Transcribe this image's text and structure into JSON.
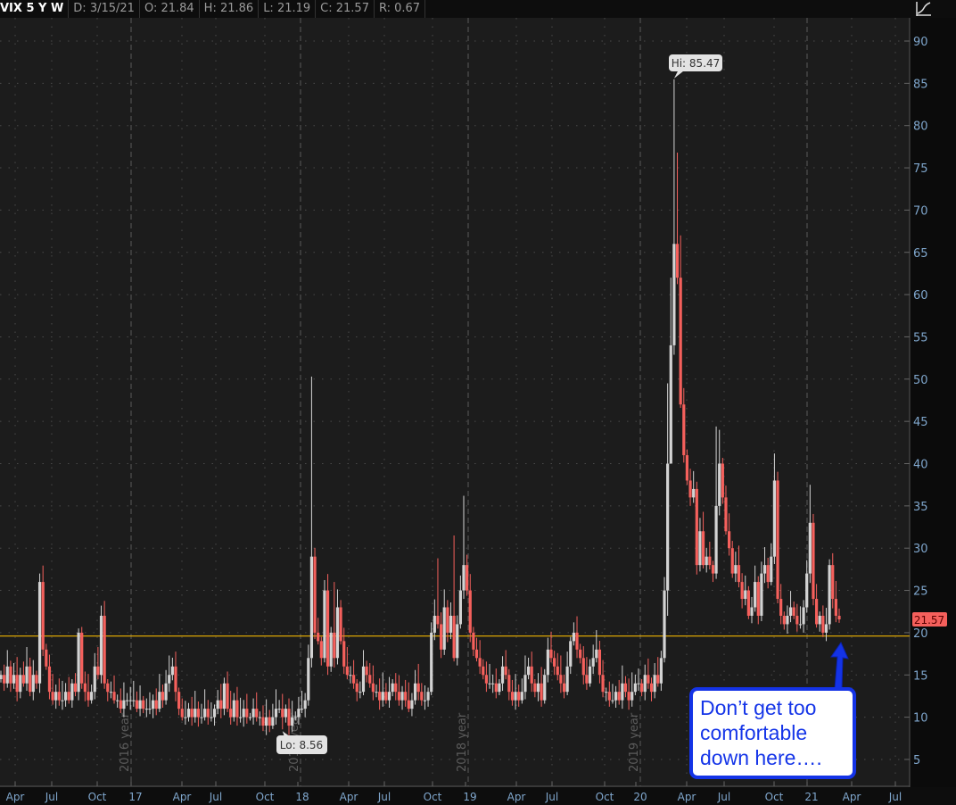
{
  "header": {
    "symbol": "VIX 5 Y W",
    "date": "D: 3/15/21",
    "open": "O: 21.84",
    "high": "H: 21.86",
    "low": "L: 21.19",
    "close": "C: 21.57",
    "range": "R: 0.67"
  },
  "icons": {
    "top_right": "study-icon"
  },
  "annotation": {
    "text_lines": [
      "Don’t get too",
      "comfortable",
      "down here…."
    ],
    "color": "#1433e6"
  },
  "colors": {
    "up": "#d3d3d3",
    "down": "#f5605c",
    "level_line": "#f0b400",
    "axis_text": "#7fa6cc",
    "background": "#1c1c1c"
  },
  "chart_data": {
    "type": "candlestick",
    "title": "VIX 5 Y W",
    "interval": "weekly",
    "ylim": [
      1,
      93
    ],
    "y_ticks": [
      5,
      10,
      15,
      20,
      25,
      30,
      35,
      40,
      45,
      50,
      55,
      60,
      65,
      70,
      75,
      80,
      85,
      90
    ],
    "x_tick_labels": [
      "Apr",
      "Jul",
      "Oct",
      "17",
      "Apr",
      "Jul",
      "Oct",
      "18",
      "Apr",
      "Jul",
      "Oct",
      "19",
      "Apr",
      "Jul",
      "Oct",
      "20",
      "Apr",
      "Jul",
      "Oct",
      "21",
      "Apr",
      "Jul"
    ],
    "year_separators": [
      "2016 year",
      "2017 year",
      "2018 year",
      "2019 year",
      ""
    ],
    "closes": [
      15,
      14,
      16,
      14,
      15,
      13,
      15,
      14,
      16,
      13,
      15,
      14,
      26,
      18,
      16,
      13,
      12,
      13,
      12,
      12,
      13,
      12,
      14,
      13,
      20,
      14,
      13,
      12,
      13,
      16,
      15,
      22,
      14,
      13,
      13,
      12,
      12,
      11,
      12,
      12,
      12,
      12,
      11,
      12,
      11,
      11,
      11,
      12,
      11,
      13,
      12,
      14,
      15,
      16,
      13,
      11,
      10,
      10,
      11,
      10,
      11,
      10,
      10,
      11,
      10,
      10,
      11,
      12,
      11,
      14,
      11,
      10,
      12,
      10,
      10,
      11,
      10,
      10,
      11,
      10,
      10,
      9,
      10,
      9,
      10,
      11,
      11,
      10,
      11,
      9,
      10,
      10,
      11,
      11,
      12,
      17,
      29,
      20,
      19,
      17,
      25,
      16,
      20,
      17,
      23,
      19,
      16,
      15,
      15,
      14,
      13,
      13,
      16,
      15,
      14,
      13,
      13,
      12,
      13,
      12,
      13,
      14,
      13,
      12,
      13,
      12,
      11,
      12,
      14,
      13,
      12,
      12,
      13,
      20,
      22,
      21,
      18,
      23,
      20,
      22,
      17,
      21,
      25,
      28,
      25,
      20,
      18,
      17,
      16,
      15,
      14,
      14,
      14,
      13,
      14,
      16,
      15,
      13,
      12,
      13,
      12,
      13,
      15,
      16,
      14,
      13,
      14,
      12,
      15,
      18,
      17,
      16,
      15,
      14,
      13,
      16,
      19,
      20,
      18,
      17,
      15,
      14,
      16,
      17,
      18,
      15,
      13,
      13,
      12,
      12,
      13,
      12,
      14,
      13,
      12,
      13,
      14,
      14,
      13,
      15,
      14,
      13,
      15,
      14,
      17,
      25,
      40,
      54,
      66,
      62,
      47,
      41,
      38,
      36,
      37,
      28,
      32,
      28,
      29,
      28,
      27,
      35,
      40,
      36,
      32,
      30,
      27,
      28,
      26,
      24,
      25,
      22,
      23,
      26,
      22,
      27,
      28,
      26,
      29,
      38,
      24,
      22,
      21,
      22,
      23,
      22,
      21,
      21,
      23,
      27,
      33,
      24,
      21,
      22,
      20,
      21,
      28,
      24,
      22,
      21.57
    ],
    "first_open": 14.5,
    "high_overrides": {
      "12": 27,
      "24": 20.5,
      "31": 23.2,
      "96": 50.3,
      "103": 26,
      "135": 28.8,
      "140": 31.5,
      "143": 36.2,
      "206": 49.5,
      "207": 62,
      "208": 85.47,
      "209": 76.8,
      "210": 67,
      "221": 44.4,
      "222": 44,
      "239": 41.2,
      "250": 37.5
    },
    "low_overrides": {
      "87": 8.56,
      "206": 22,
      "207": 40
    },
    "level_line": 19.6,
    "last_price": "21.57",
    "hi_label": "Hi: 85.47",
    "lo_label": "Lo: 8.56",
    "grid": true
  }
}
